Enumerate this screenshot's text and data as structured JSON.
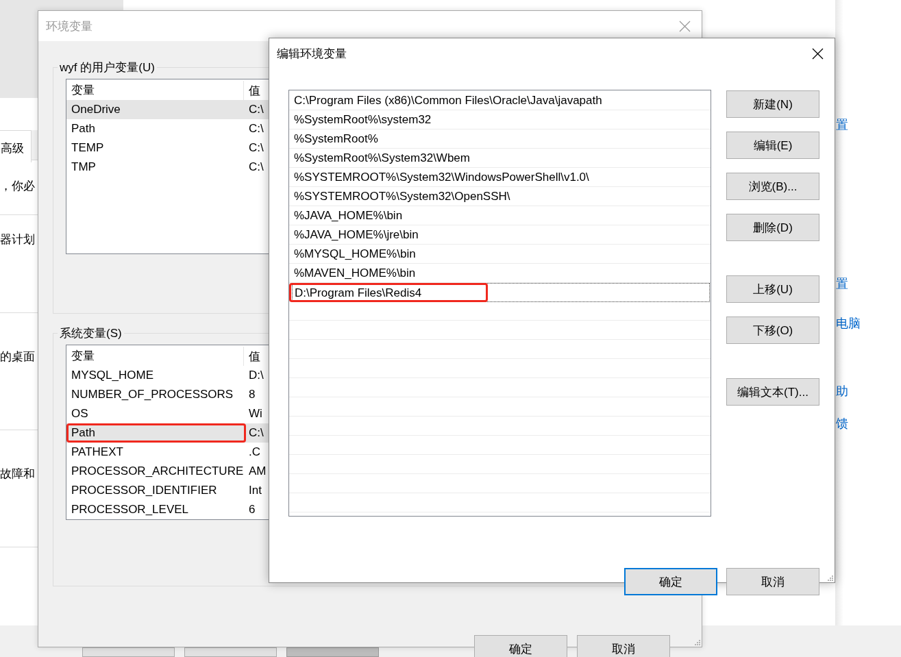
{
  "background_window": {
    "tab": {
      "label": "高级",
      "selected": true
    },
    "fragments": [
      "，你必",
      "器计划",
      "的桌面",
      "故障和"
    ],
    "links": [
      "置",
      "置",
      "电脑",
      "助",
      "馈"
    ],
    "buttons": [
      {
        "disabled": false
      },
      {
        "disabled": false
      },
      {
        "disabled": true
      }
    ]
  },
  "env_window": {
    "title": "环境变量",
    "active": false,
    "groups": [
      {
        "title": "wyf 的用户变量(U)",
        "columns": [
          "变量",
          "值"
        ],
        "rows": [
          {
            "name": "OneDrive",
            "value": "C:\\",
            "selected": true,
            "highlighted": false
          },
          {
            "name": "Path",
            "value": "C:\\",
            "selected": false,
            "highlighted": false
          },
          {
            "name": "TEMP",
            "value": "C:\\",
            "selected": false,
            "highlighted": false
          },
          {
            "name": "TMP",
            "value": "C:\\",
            "selected": false,
            "highlighted": false
          }
        ]
      },
      {
        "title": "系统变量(S)",
        "columns": [
          "变量",
          "值"
        ],
        "rows": [
          {
            "name": "MYSQL_HOME",
            "value": "D:\\",
            "selected": false,
            "highlighted": false
          },
          {
            "name": "NUMBER_OF_PROCESSORS",
            "value": "8",
            "selected": false,
            "highlighted": false
          },
          {
            "name": "OS",
            "value": "Wi",
            "selected": false,
            "highlighted": false
          },
          {
            "name": "Path",
            "value": "C:\\",
            "selected": true,
            "highlighted": true
          },
          {
            "name": "PATHEXT",
            "value": ".C",
            "selected": false,
            "highlighted": false
          },
          {
            "name": "PROCESSOR_ARCHITECTURE",
            "value": "AM",
            "selected": false,
            "highlighted": false
          },
          {
            "name": "PROCESSOR_IDENTIFIER",
            "value": "Int",
            "selected": false,
            "highlighted": false
          },
          {
            "name": "PROCESSOR_LEVEL",
            "value": "6",
            "selected": false,
            "highlighted": false
          }
        ]
      }
    ],
    "buttons": [
      {
        "label": "确定",
        "default": false
      },
      {
        "label": "取消",
        "default": false
      }
    ]
  },
  "edit_dialog": {
    "title": "编辑环境变量",
    "active": true,
    "entries": [
      {
        "text": "C:\\Program Files (x86)\\Common Files\\Oracle\\Java\\javapath",
        "selected": false,
        "highlighted": false
      },
      {
        "text": "%SystemRoot%\\system32",
        "selected": false,
        "highlighted": false
      },
      {
        "text": "%SystemRoot%",
        "selected": false,
        "highlighted": false
      },
      {
        "text": "%SystemRoot%\\System32\\Wbem",
        "selected": false,
        "highlighted": false
      },
      {
        "text": "%SYSTEMROOT%\\System32\\WindowsPowerShell\\v1.0\\",
        "selected": false,
        "highlighted": false
      },
      {
        "text": "%SYSTEMROOT%\\System32\\OpenSSH\\",
        "selected": false,
        "highlighted": false
      },
      {
        "text": "%JAVA_HOME%\\bin",
        "selected": false,
        "highlighted": false
      },
      {
        "text": "%JAVA_HOME%\\jre\\bin",
        "selected": false,
        "highlighted": false
      },
      {
        "text": "%MYSQL_HOME%\\bin",
        "selected": false,
        "highlighted": false
      },
      {
        "text": "%MAVEN_HOME%\\bin",
        "selected": false,
        "highlighted": false
      },
      {
        "text": "D:\\Program Files\\Redis4",
        "selected": true,
        "highlighted": true
      }
    ],
    "side_buttons": [
      [
        "新建(N)",
        "编辑(E)",
        "浏览(B)...",
        "删除(D)"
      ],
      [
        "上移(U)",
        "下移(O)"
      ],
      [
        "编辑文本(T)..."
      ]
    ],
    "buttons": [
      {
        "label": "确定",
        "default": true
      },
      {
        "label": "取消",
        "default": false
      }
    ]
  }
}
